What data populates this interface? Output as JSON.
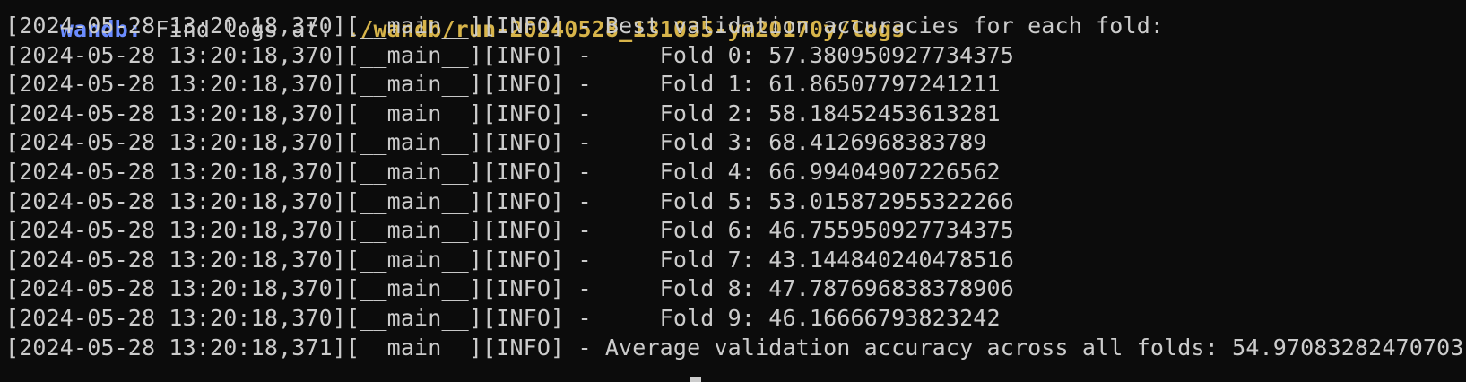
{
  "terminal": {
    "top_line": {
      "prefix": "wandb:",
      "text": " Find logs at: ",
      "path": "./wandb/run-20240528_131035-ym20170y/logs"
    },
    "header": "[2024-05-28 13:20:18,370][__main__][INFO] - Best validation accuracies for each fold:",
    "folds": [
      "[2024-05-28 13:20:18,370][__main__][INFO] -     Fold 0: 57.380950927734375",
      "[2024-05-28 13:20:18,370][__main__][INFO] -     Fold 1: 61.86507797241211",
      "[2024-05-28 13:20:18,370][__main__][INFO] -     Fold 2: 58.18452453613281",
      "[2024-05-28 13:20:18,370][__main__][INFO] -     Fold 3: 68.4126968383789",
      "[2024-05-28 13:20:18,370][__main__][INFO] -     Fold 4: 66.99404907226562",
      "[2024-05-28 13:20:18,370][__main__][INFO] -     Fold 5: 53.015872955322266",
      "[2024-05-28 13:20:18,370][__main__][INFO] -     Fold 6: 46.755950927734375",
      "[2024-05-28 13:20:18,370][__main__][INFO] -     Fold 7: 43.144840240478516",
      "[2024-05-28 13:20:18,370][__main__][INFO] -     Fold 8: 47.787696838378906",
      "[2024-05-28 13:20:18,370][__main__][INFO] -     Fold 9: 46.16666793823242"
    ],
    "footer": "[2024-05-28 13:20:18,371][__main__][INFO] - Average validation accuracy across all folds: 54.97083282470703",
    "colors": {
      "background": "#0c0c0c",
      "text": "#cccccc",
      "wandb": "#6b8cff",
      "path": "#d7b44a"
    }
  }
}
